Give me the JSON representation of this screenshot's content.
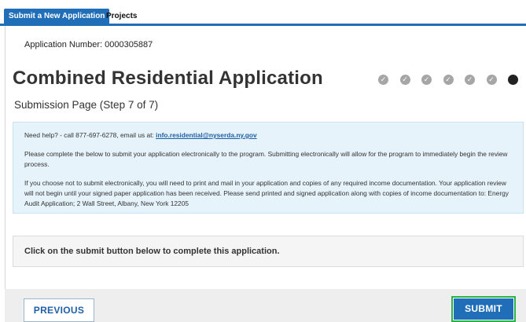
{
  "tabs": [
    {
      "label": "Submit a New Application",
      "active": true
    },
    {
      "label": "Projects",
      "active": false
    }
  ],
  "header": {
    "application_number": "Application Number: 0000305887",
    "title": "Combined Residential Application",
    "subtitle": "Submission Page  (Step 7 of 7)"
  },
  "progress": {
    "total_steps": 7,
    "current_step": 7,
    "completed_icon": "check-icon",
    "completed_color": "#a6a6a6",
    "current_color": "#222222",
    "check_glyph": "✓"
  },
  "help": {
    "line1_text": "Need help? - call 877-697-6278, email us at:  ",
    "line1_email": "info.residential@nyserda.ny.gov",
    "line2": "Please complete the below to submit your application electronically to the program.  Submitting electronically will allow for the program to immediately begin the review process.",
    "line3": "If you choose not to submit electronically, you will need to print and mail in your application and copies of any required income documentation.  Your application review will not begin until your signed paper application has been received.  Please send printed and signed application along with copies of income documentation to: Energy Audit Application; 2 Wall Street, Albany, New York 12205"
  },
  "instruction": "Click on the submit button below to complete this application.",
  "buttons": {
    "previous": "PREVIOUS",
    "submit": "SUBMIT"
  },
  "colors": {
    "brand_blue": "#1f6eb7",
    "highlight_green": "#27b24a",
    "help_bg": "#e6f3fa"
  }
}
